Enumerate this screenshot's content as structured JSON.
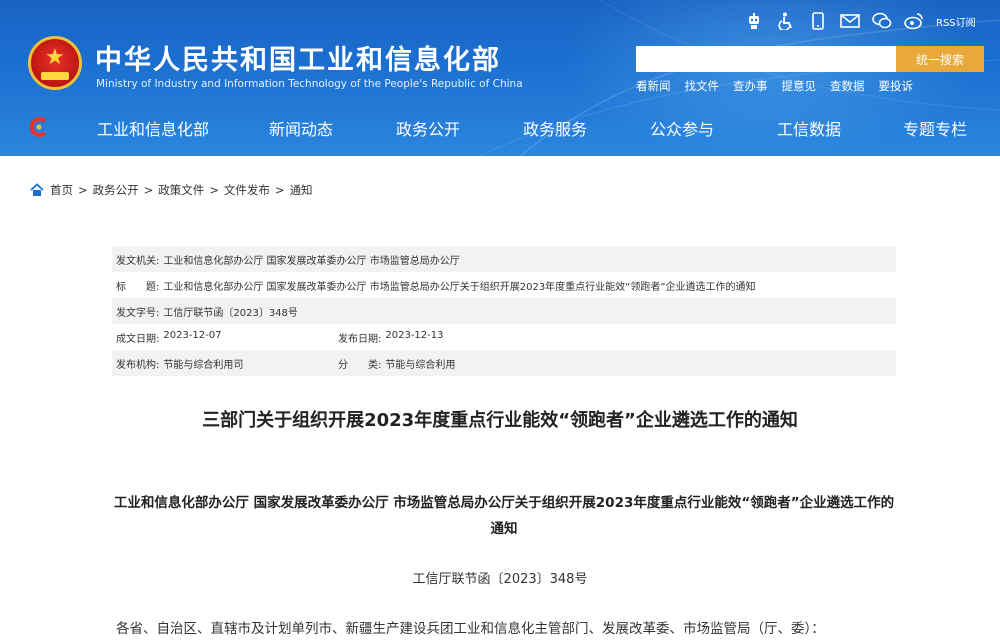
{
  "header": {
    "title_cn": "中华人民共和国工业和信息化部",
    "title_en": "Ministry of Industry and Information Technology of the People's Republic of China",
    "icons": [
      "robot-icon",
      "accessibility-icon",
      "mobile-icon",
      "mail-icon",
      "wechat-icon",
      "weibo-icon"
    ],
    "rss_label": "RSS订阅",
    "search_placeholder": "",
    "search_button": "统一搜索",
    "quick_links": [
      "看新闻",
      "找文件",
      "查办事",
      "提意见",
      "查数据",
      "要投诉"
    ]
  },
  "nav": {
    "items": [
      "工业和信息化部",
      "新闻动态",
      "政务公开",
      "政务服务",
      "公众参与",
      "工信数据",
      "专题专栏"
    ]
  },
  "breadcrumb": [
    "首页",
    "政务公开",
    "政策文件",
    "文件发布",
    "通知"
  ],
  "meta": {
    "issuer_label": "发文机关:",
    "issuer_value": "工业和信息化部办公厅 国家发展改革委办公厅 市场监管总局办公厅",
    "title_label": "标　　题:",
    "title_value": "工业和信息化部办公厅 国家发展改革委办公厅 市场监管总局办公厅关于组织开展2023年度重点行业能效“领跑者”企业遴选工作的通知",
    "docno_label": "发文字号:",
    "docno_value": "工信厅联节函〔2023〕348号",
    "created_label": "成文日期:",
    "created_value": "2023-12-07",
    "published_label": "发布日期:",
    "published_value": "2023-12-13",
    "org_label": "发布机构:",
    "org_value": "节能与综合利用司",
    "category_label": "分　　类:",
    "category_value": "节能与综合利用"
  },
  "document": {
    "title": "三部门关于组织开展2023年度重点行业能效“领跑者”企业遴选工作的通知",
    "subtitle": "工业和信息化部办公厅 国家发展改革委办公厅 市场监管总局办公厅关于组织开展2023年度重点行业能效“领跑者”企业遴选工作的通知",
    "doc_number": "工信厅联节函〔2023〕348号",
    "addressee": "各省、自治区、直辖市及计划单列市、新疆生产建设兵团工业和信息化主管部门、发展改革委、市场监管局（厅、委）："
  }
}
